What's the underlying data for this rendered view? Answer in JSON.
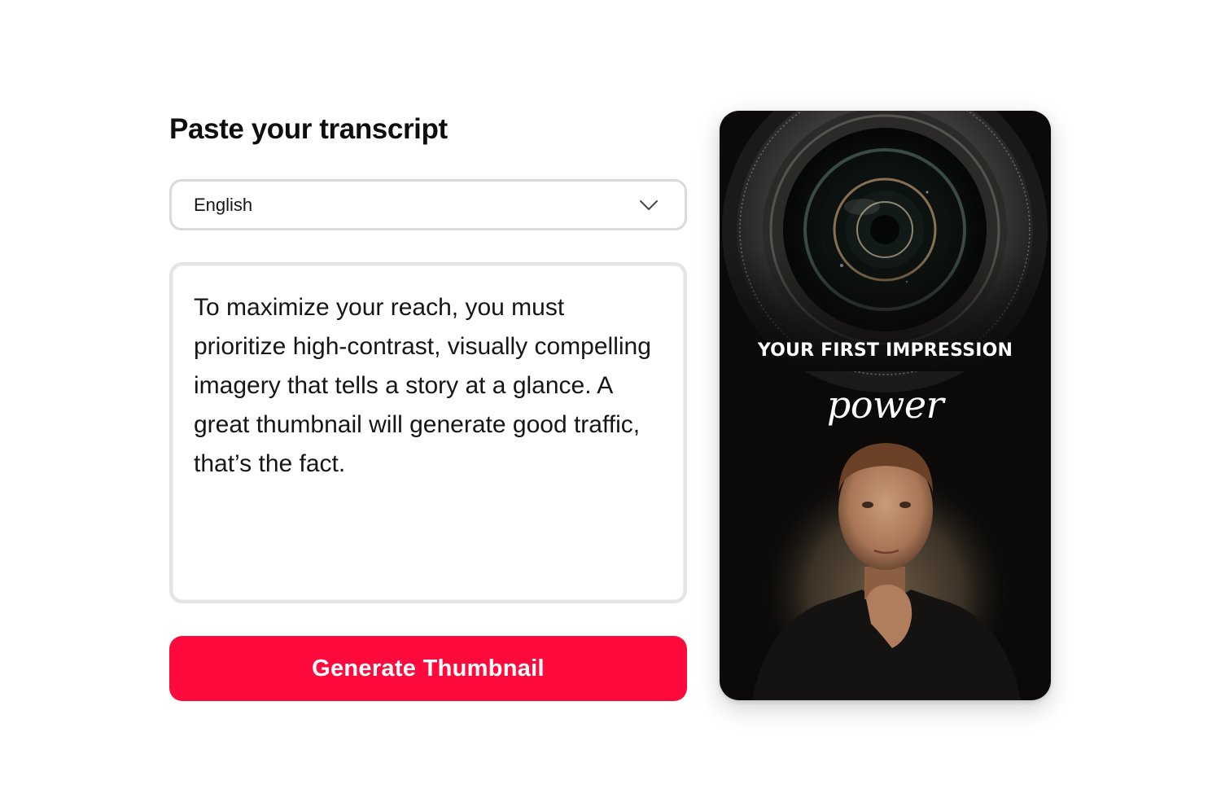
{
  "form": {
    "title": "Paste your transcript",
    "language": {
      "selected": "English",
      "icon": "chevron-down-icon"
    },
    "transcript": "To maximize your reach, you must prioritize high-contrast, visually compelling imagery that tells a story at a glance. A great thumbnail will generate good traffic, that’s the fact.",
    "generate_label": "Generate Thumbnail"
  },
  "thumbnail": {
    "headline": "YOUR FIRST IMPRESSION",
    "script_word": "power"
  },
  "colors": {
    "accent": "#ff0a3c",
    "border": "#dadada",
    "thumbnail_bg": "#0b0a09"
  }
}
